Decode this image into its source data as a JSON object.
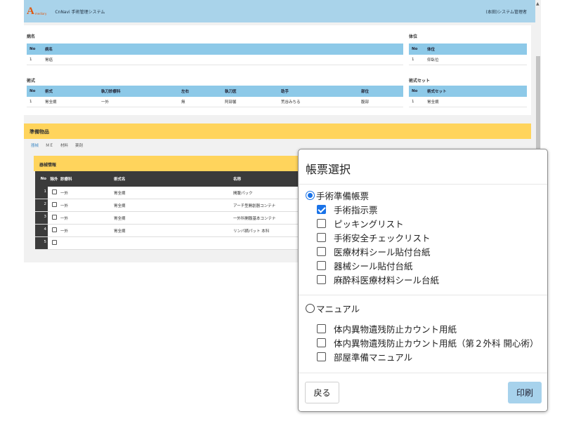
{
  "header": {
    "logo_mark": "A",
    "logo_sub": "mediary",
    "title": "CnNavi 手術管理システム",
    "user": "(本田)システム管理者"
  },
  "disease": {
    "label": "病名",
    "headers": [
      "No",
      "病名"
    ],
    "rows": [
      [
        "1",
        "胃癌"
      ]
    ]
  },
  "position": {
    "label": "体位",
    "headers": [
      "No",
      "体位"
    ],
    "rows": [
      [
        "1",
        "仰臥位"
      ]
    ]
  },
  "procedure": {
    "label": "術式",
    "headers": [
      "No",
      "術式",
      "執刀診療科",
      "左右",
      "執刀医",
      "助手",
      "部位"
    ],
    "rows": [
      [
        "1",
        "胃全摘",
        "一外",
        "無",
        "阿部馨",
        "荒谷みちる",
        "腹部"
      ]
    ]
  },
  "procedure_set": {
    "label": "術式セット",
    "headers": [
      "No",
      "術式セット"
    ],
    "rows": [
      [
        "1",
        "胃全摘"
      ]
    ]
  },
  "prep": {
    "title": "準備物品",
    "tabs": [
      "器械",
      "ＭＥ",
      "材料",
      "薬剤"
    ]
  },
  "kit": {
    "title": "器械情報",
    "headers": [
      "No",
      "除外",
      "診療科",
      "術式名",
      "名称"
    ],
    "rows": [
      [
        "1",
        "一外",
        "胃全摘",
        "開腹パック"
      ],
      [
        "2",
        "一外",
        "胃全摘",
        "アーチ型開創器コンテナ"
      ],
      [
        "3",
        "一外",
        "胃全摘",
        "一外科開腹基本コンテナ"
      ],
      [
        "4",
        "一外",
        "胃全摘",
        "リンパ摘パット 本科"
      ],
      [
        "5",
        "",
        "",
        ""
      ]
    ]
  },
  "dialog": {
    "title": "帳票選択",
    "group1": {
      "label": "手術準備帳票",
      "selected": true,
      "items": [
        {
          "label": "手術指示票",
          "checked": true
        },
        {
          "label": "ピッキングリスト",
          "checked": false
        },
        {
          "label": "手術安全チェックリスト",
          "checked": false
        },
        {
          "label": "医療材料シール貼付台紙",
          "checked": false
        },
        {
          "label": "器械シール貼付台紙",
          "checked": false
        },
        {
          "label": "麻酔科医療材料シール台紙",
          "checked": false
        }
      ]
    },
    "group2": {
      "label": "マニュアル",
      "selected": false,
      "items": [
        {
          "label": "体内異物遺残防止カウント用紙",
          "checked": false
        },
        {
          "label": "体内異物遺残防止カウント用紙（第２外科 開心術）",
          "checked": false
        },
        {
          "label": "部屋準備マニュアル",
          "checked": false
        }
      ]
    },
    "back_label": "戻る",
    "print_label": "印刷"
  },
  "colors": {
    "header_bg": "#a9d3ea",
    "table_head": "#8dc9e8",
    "section_yellow": "#ffd45c",
    "accent": "#1a73e8",
    "print_button": "#a7d2ec"
  }
}
